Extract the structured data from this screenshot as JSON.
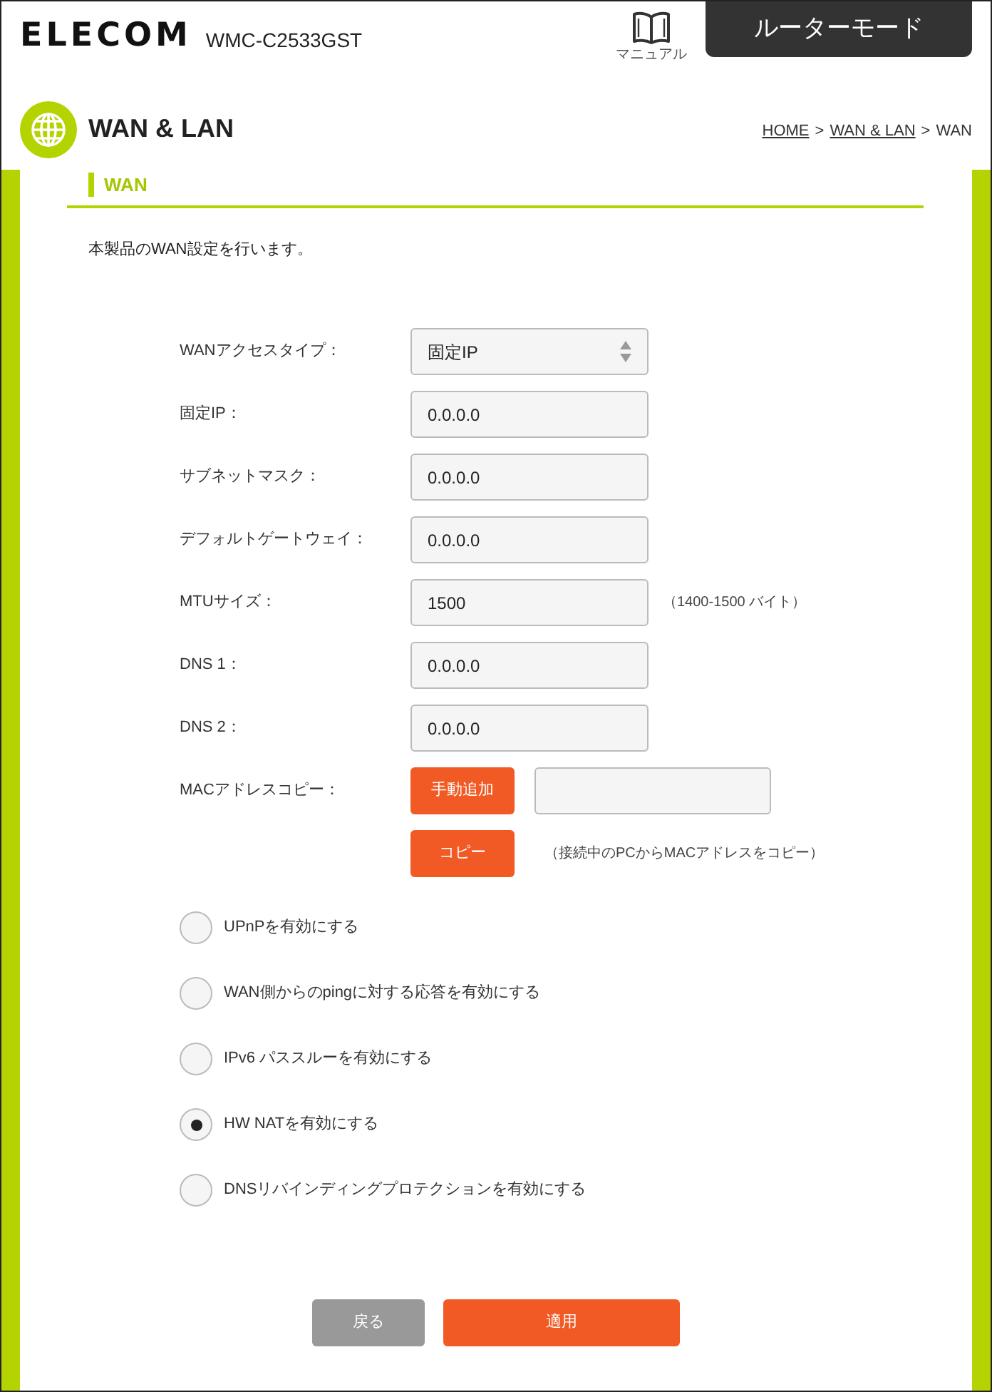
{
  "header": {
    "logo": "ELECOM",
    "model": "WMC-C2533GST",
    "manual_label": "マニュアル",
    "mode_tab": "ルーターモード"
  },
  "page": {
    "title": "WAN & LAN",
    "breadcrumb": [
      {
        "label": "HOME",
        "link": true
      },
      {
        "separator": ">",
        "label": "WAN & LAN",
        "link": true
      },
      {
        "separator": ">",
        "label": "WAN",
        "link": false
      }
    ]
  },
  "section": {
    "title": "WAN",
    "description": "本製品のWAN設定を行います。"
  },
  "fields": [
    {
      "kind": "select",
      "label": "WANアクセスタイプ：",
      "value": "固定IP"
    },
    {
      "kind": "text",
      "label": "固定IP：",
      "value": "0.0.0.0"
    },
    {
      "kind": "text",
      "label": "サブネットマスク：",
      "value": "0.0.0.0"
    },
    {
      "kind": "text",
      "label": "デフォルトゲートウェイ：",
      "value": "0.0.0.0"
    },
    {
      "kind": "text",
      "label": "MTUサイズ：",
      "value": "1500",
      "note": "（1400-1500 バイト）"
    },
    {
      "kind": "text",
      "label": "DNS 1：",
      "value": "0.0.0.0"
    },
    {
      "kind": "text",
      "label": "DNS 2：",
      "value": "0.0.0.0"
    },
    {
      "kind": "mac",
      "label": "MACアドレスコピー：",
      "add_button": "手動追加",
      "copy_button": "コピー",
      "note": "（接続中のPCからMACアドレスをコピー）"
    }
  ],
  "options": [
    {
      "label": "UPnPを有効にする",
      "checked": false
    },
    {
      "label": "WAN側からのpingに対する応答を有効にする",
      "checked": false
    },
    {
      "label": "IPv6 パススルーを有効にする",
      "checked": false
    },
    {
      "label": "HW NATを有効にする",
      "checked": true
    },
    {
      "label": "DNSリバインディングプロテクションを有効にする",
      "checked": false
    }
  ],
  "buttons": [
    {
      "kind": "back",
      "label": "戻る"
    },
    {
      "kind": "apply",
      "label": "適用"
    }
  ]
}
